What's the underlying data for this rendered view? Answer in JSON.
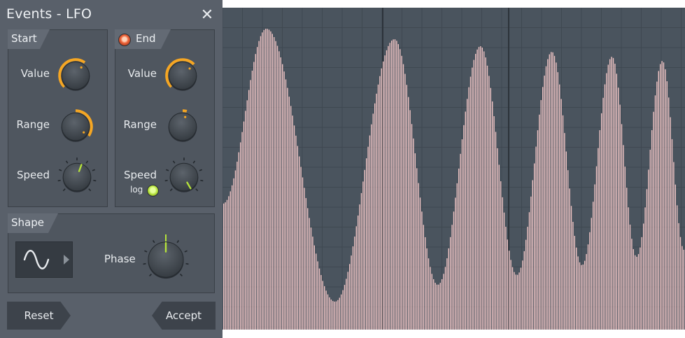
{
  "window": {
    "title": "Events - LFO"
  },
  "start": {
    "tab": "Start",
    "value_label": "Value",
    "range_label": "Range",
    "speed_label": "Speed"
  },
  "end": {
    "tab": "End",
    "value_label": "Value",
    "range_label": "Range",
    "speed_label": "Speed",
    "log_label": "log"
  },
  "shape": {
    "tab": "Shape",
    "phase_label": "Phase",
    "waveform": "sine"
  },
  "buttons": {
    "reset": "Reset",
    "accept": "Accept"
  },
  "icons": {
    "close": "close-icon",
    "wave": "sine-wave-icon",
    "arrow": "triangle-right-icon"
  },
  "colors": {
    "accent": "#f5a623",
    "green": "#b5e23b",
    "wave_fill": "#f2c6c6",
    "graph_bg": "#4a545e",
    "panel": "#59606a"
  }
}
